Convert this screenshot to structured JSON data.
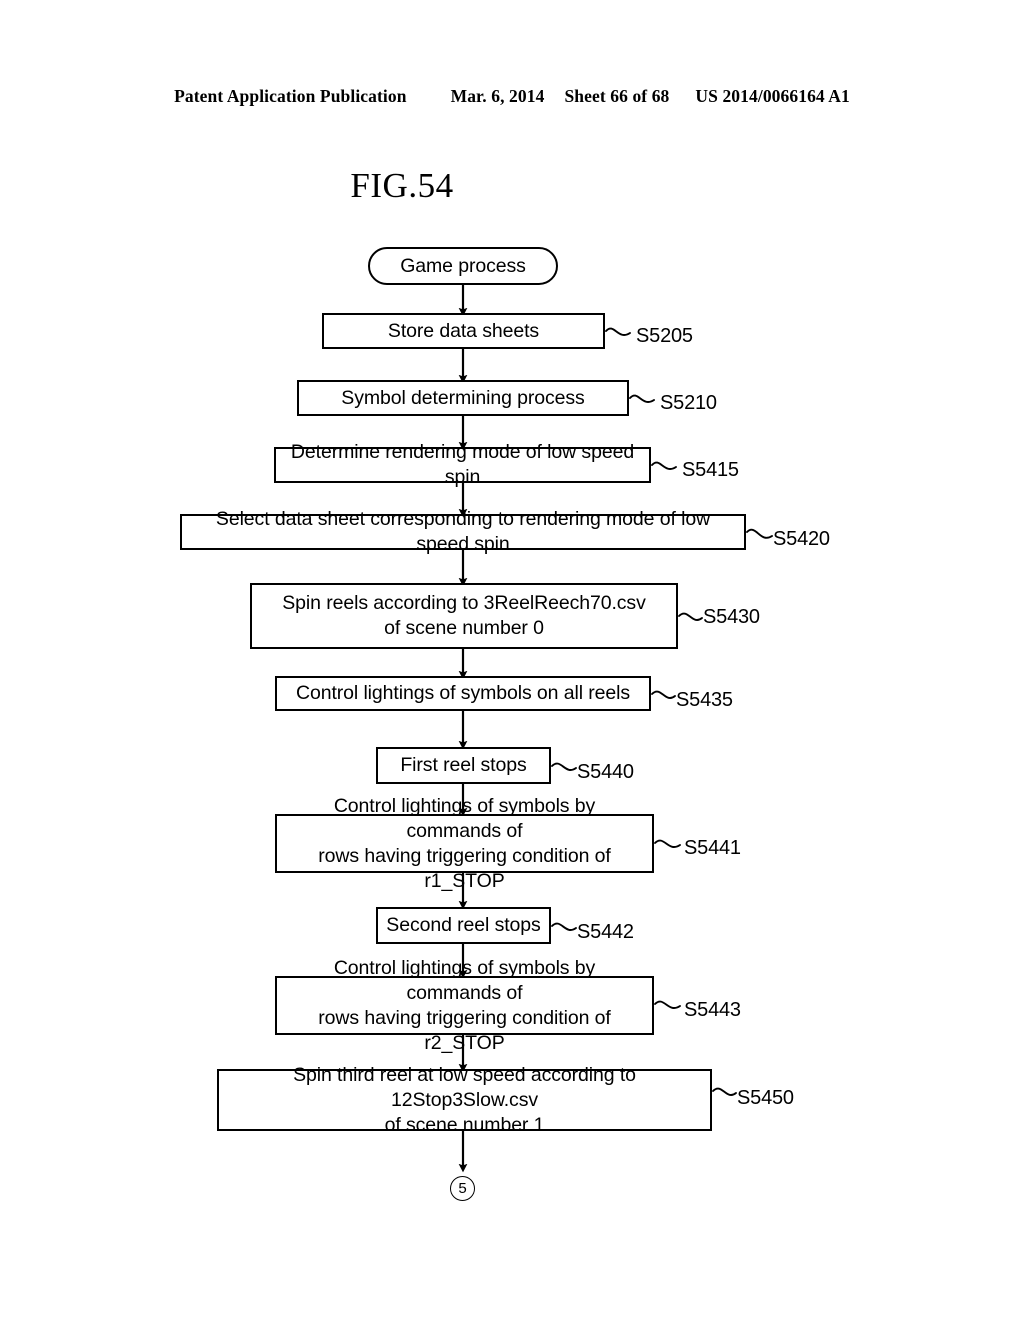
{
  "header": {
    "publication": "Patent Application Publication",
    "date": "Mar. 6, 2014",
    "sheet": "Sheet 66 of 68",
    "patent_number": "US 2014/0066164 A1"
  },
  "figure": {
    "title": "FIG.54"
  },
  "flowchart": {
    "start": {
      "label": "Game process",
      "shape": "rounded-terminator"
    },
    "end_connector": {
      "label": "5",
      "shape": "circle"
    },
    "steps": [
      {
        "id": "s5205",
        "text": "Store data sheets",
        "ref": "S5205"
      },
      {
        "id": "s5210",
        "text": "Symbol determining process",
        "ref": "S5210"
      },
      {
        "id": "s5415",
        "text": "Determine rendering mode of low speed spin",
        "ref": "S5415"
      },
      {
        "id": "s5420",
        "text": "Select data sheet corresponding to rendering mode of low speed spin",
        "ref": "S5420"
      },
      {
        "id": "s5430",
        "line1": "Spin reels according to 3ReelReech70.csv",
        "line2": "of scene number 0",
        "ref": "S5430"
      },
      {
        "id": "s5435",
        "text": "Control lightings of symbols on all reels",
        "ref": "S5435"
      },
      {
        "id": "s5440",
        "text": "First reel stops",
        "ref": "S5440"
      },
      {
        "id": "s5441",
        "line1": "Control lightings of symbols by commands of",
        "line2": "rows having triggering condition of r1_STOP",
        "ref": "S5441"
      },
      {
        "id": "s5442",
        "text": "Second reel stops",
        "ref": "S5442"
      },
      {
        "id": "s5443",
        "line1": "Control lightings of symbols by commands of",
        "line2": "rows having triggering condition of r2_STOP",
        "ref": "S5443"
      },
      {
        "id": "s5450",
        "line1": "Spin third reel at low speed according to 12Stop3Slow.csv",
        "line2": "of scene number 1",
        "ref": "S5450"
      }
    ]
  },
  "colors": {
    "ink": "#000000",
    "paper": "#ffffff"
  }
}
